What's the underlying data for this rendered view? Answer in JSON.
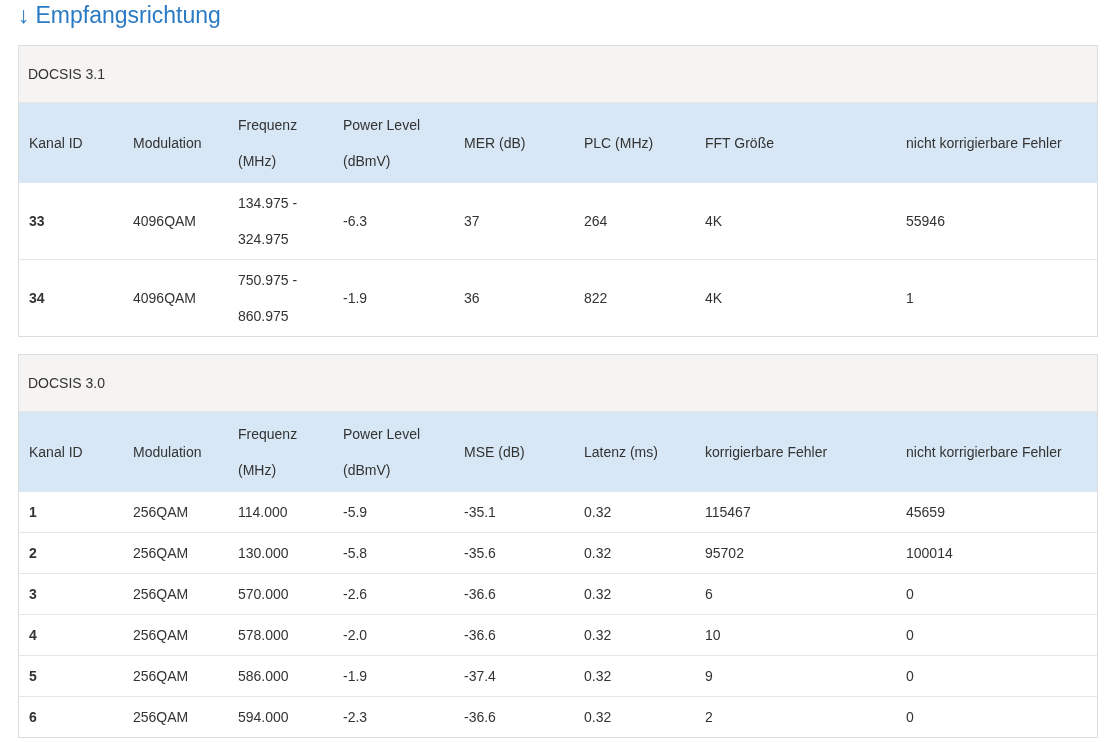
{
  "heading": {
    "arrow": "↓",
    "title": "Empfangsrichtung"
  },
  "sections": [
    {
      "title": "DOCSIS 3.1",
      "columns": [
        "Kanal ID",
        "Modulation",
        "Frequenz (MHz)",
        "Power Level (dBmV)",
        "MER (dB)",
        "PLC (MHz)",
        "FFT Größe",
        "nicht korrigierbare Fehler"
      ],
      "rows": [
        [
          "33",
          "4096QAM",
          "134.975 - 324.975",
          "-6.3",
          "37",
          "264",
          "4K",
          "55946"
        ],
        [
          "34",
          "4096QAM",
          "750.975 - 860.975",
          "-1.9",
          "36",
          "822",
          "4K",
          "1"
        ]
      ]
    },
    {
      "title": "DOCSIS 3.0",
      "columns": [
        "Kanal ID",
        "Modulation",
        "Frequenz (MHz)",
        "Power Level (dBmV)",
        "MSE (dB)",
        "Latenz (ms)",
        "korrigierbare Fehler",
        "nicht korrigierbare Fehler"
      ],
      "rows": [
        [
          "1",
          "256QAM",
          "114.000",
          "-5.9",
          "-35.1",
          "0.32",
          "115467",
          "45659"
        ],
        [
          "2",
          "256QAM",
          "130.000",
          "-5.8",
          "-35.6",
          "0.32",
          "95702",
          "100014"
        ],
        [
          "3",
          "256QAM",
          "570.000",
          "-2.6",
          "-36.6",
          "0.32",
          "6",
          "0"
        ],
        [
          "4",
          "256QAM",
          "578.000",
          "-2.0",
          "-36.6",
          "0.32",
          "10",
          "0"
        ],
        [
          "5",
          "256QAM",
          "586.000",
          "-1.9",
          "-37.4",
          "0.32",
          "9",
          "0"
        ],
        [
          "6",
          "256QAM",
          "594.000",
          "-2.3",
          "-36.6",
          "0.32",
          "2",
          "0"
        ]
      ]
    }
  ]
}
